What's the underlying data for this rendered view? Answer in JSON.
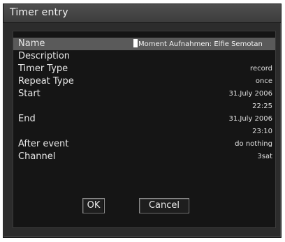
{
  "window": {
    "title": "Timer entry"
  },
  "fields": {
    "name": {
      "label": "Name",
      "value": "Moment Aufnahmen: Elfie Semotan"
    },
    "description": {
      "label": "Description",
      "value": ""
    },
    "timer_type": {
      "label": "Timer Type",
      "value": "record"
    },
    "repeat_type": {
      "label": "Repeat Type",
      "value": "once"
    },
    "start": {
      "label": "Start",
      "date": "31.July 2006",
      "time": "22:25"
    },
    "end": {
      "label": "End",
      "date": "31.July 2006",
      "time": "23:10"
    },
    "after_event": {
      "label": "After event",
      "value": "do nothing"
    },
    "channel": {
      "label": "Channel",
      "value": "3sat"
    }
  },
  "buttons": {
    "ok": "OK",
    "cancel": "Cancel"
  },
  "colors": {
    "dialog_bg": "#2c2c2c",
    "content_bg": "#151515",
    "selected_row": "#5a5a5a",
    "text": "#e8e8e8"
  }
}
